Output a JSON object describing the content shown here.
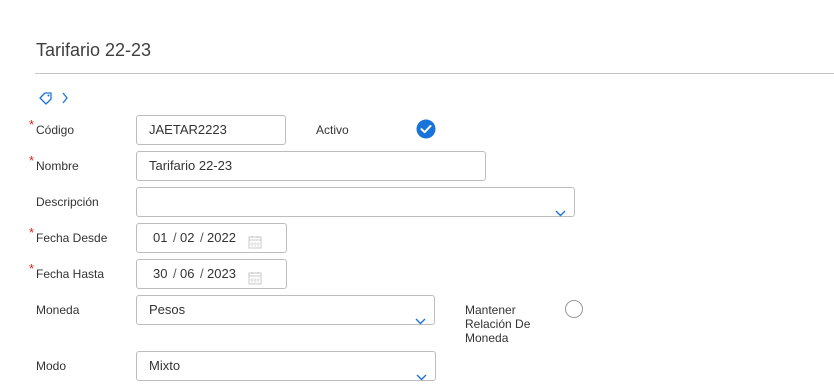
{
  "header": {
    "title": "Tarifario 22-23"
  },
  "colors": {
    "accent": "#1a73d9",
    "required": "#e02020",
    "border": "#bdbdbd"
  },
  "tagbar": {
    "tag_icon": "tag-icon",
    "chevron_icon": "chevron-right-icon"
  },
  "form": {
    "required_marker": "*",
    "codigo": {
      "label": "Código",
      "value": "JAETAR2223",
      "required": true
    },
    "activo": {
      "label": "Activo",
      "checked": true
    },
    "nombre": {
      "label": "Nombre",
      "value": "Tarifario 22-23",
      "required": true
    },
    "descripcion": {
      "label": "Descripción",
      "value": ""
    },
    "fecha_desde": {
      "label": "Fecha Desde",
      "day": "01",
      "month": "02",
      "year": "2022",
      "separator": "/",
      "required": true
    },
    "fecha_hasta": {
      "label": "Fecha Hasta",
      "day": "30",
      "month": "06",
      "year": "2023",
      "separator": "/",
      "required": true
    },
    "moneda": {
      "label": "Moneda",
      "value": "Pesos"
    },
    "mantener_relacion": {
      "label": "Mantener Relación De Moneda",
      "checked": false
    },
    "modo": {
      "label": "Modo",
      "value": "Mixto"
    }
  }
}
